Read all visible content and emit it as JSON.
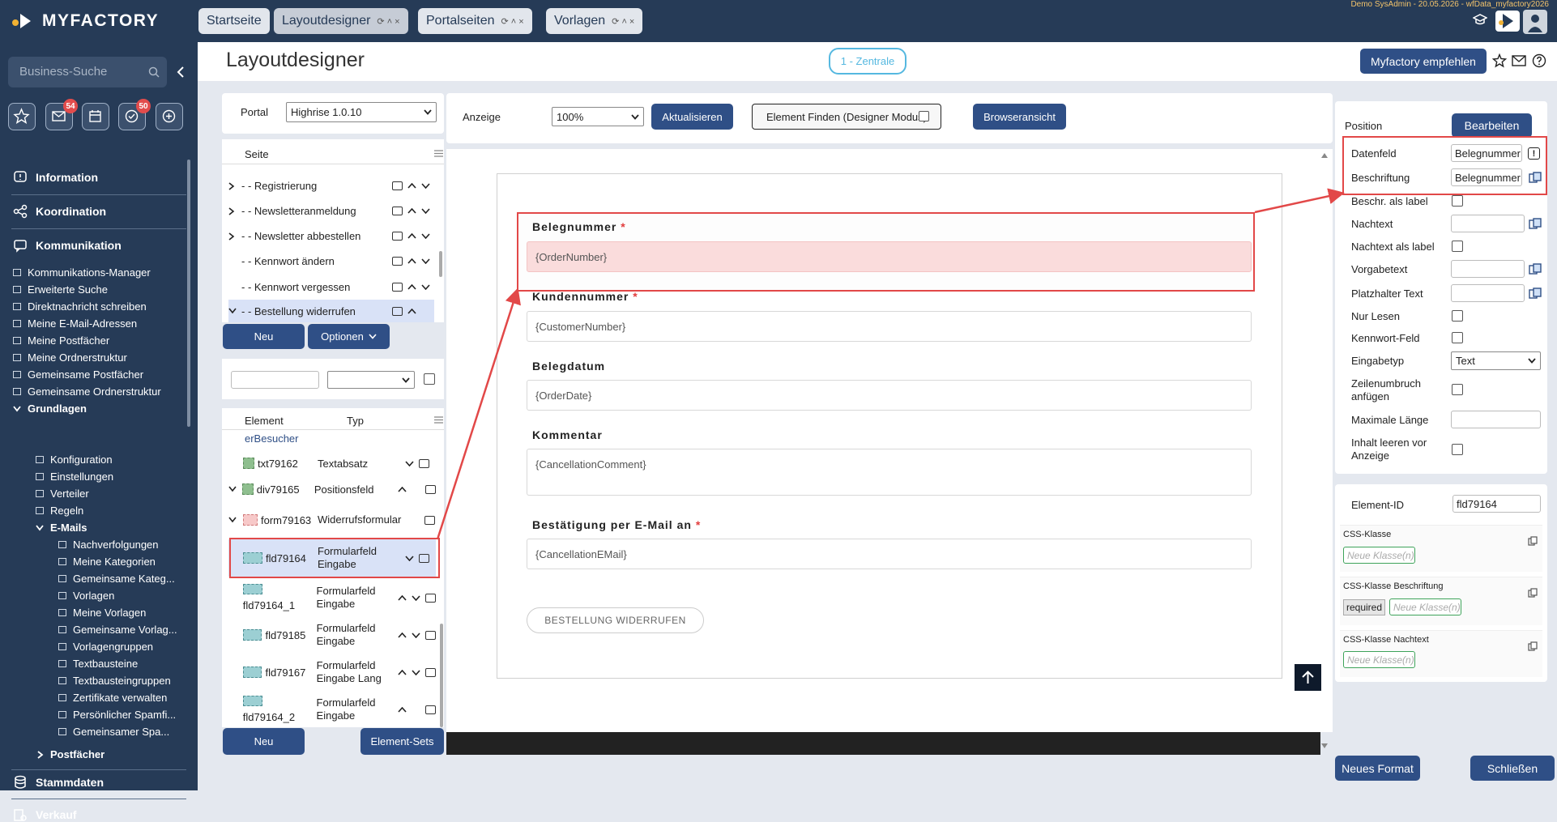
{
  "topbar": {
    "logo": "MYFACTORY",
    "tabs": [
      {
        "label": "Startseite"
      },
      {
        "label": "Layoutdesigner"
      },
      {
        "label": "Portalseiten"
      },
      {
        "label": "Vorlagen"
      }
    ],
    "tab_controls": "⟳ ˄ ×",
    "demo_info": "Demo SysAdmin - 20.05.2026 - wfData_myfactory2026"
  },
  "sidebar": {
    "search_placeholder": "Business-Suche",
    "badges": {
      "mail": "54",
      "tasks": "50"
    },
    "sections": {
      "information": "Information",
      "koordination": "Koordination",
      "kommunikation": "Kommunikation",
      "stammdaten": "Stammdaten",
      "verkauf": "Verkauf"
    },
    "kommunikation_items": [
      "Kommunikations-Manager",
      "Erweiterte Suche",
      "Direktnachricht schreiben",
      "Meine E-Mail-Adressen",
      "Meine Postfächer",
      "Meine Ordnerstruktur",
      "Gemeinsame Postfächer",
      "Gemeinsame Ordnerstruktur"
    ],
    "grundlagen": "Grundlagen",
    "grundlagen_items": [
      "Konfiguration",
      "Einstellungen",
      "Verteiler",
      "Regeln"
    ],
    "emails": "E-Mails",
    "email_items": [
      "Nachverfolgungen",
      "Meine Kategorien",
      "Gemeinsame Kateg...",
      "Vorlagen",
      "Meine Vorlagen",
      "Gemeinsame Vorlag...",
      "Vorlagengruppen",
      "Textbausteine",
      "Textbausteingruppen",
      "Zertifikate verwalten",
      "Persönlicher Spamfi...",
      "Gemeinsamer Spa..."
    ],
    "postfaecher": "Postfächer"
  },
  "header": {
    "title": "Layoutdesigner",
    "zentrale": "1 - Zentrale",
    "recommend": "Myfactory empfehlen"
  },
  "portal": {
    "label": "Portal",
    "value": "Highrise 1.0.10"
  },
  "pages": {
    "header": "Seite",
    "rows": [
      {
        "label": "- - Registrierung"
      },
      {
        "label": "- - Newsletteranmeldung"
      },
      {
        "label": "- - Newsletter abbestellen"
      },
      {
        "label": "- - Kennwort ändern"
      },
      {
        "label": "- - Kennwort vergessen"
      },
      {
        "label": "- - Bestellung widerrufen"
      }
    ],
    "new_button": "Neu",
    "options_button": "Optionen"
  },
  "elements": {
    "headers": {
      "element": "Element",
      "type": "Typ"
    },
    "partial": "erBesucher",
    "rows": [
      {
        "id": "txt79162",
        "type": "Textabsatz"
      },
      {
        "id": "div79165",
        "type": "Positionsfeld"
      },
      {
        "id": "form79163",
        "type": "Widerrufsformular"
      },
      {
        "id": "fld79164",
        "type": "Formularfeld Eingabe"
      },
      {
        "id": "fld79164_1",
        "type": "Formularfeld Eingabe"
      },
      {
        "id": "fld79185",
        "type": "Formularfeld Eingabe"
      },
      {
        "id": "fld79167",
        "type": "Formularfeld Eingabe Lang"
      },
      {
        "id": "fld79164_2",
        "type": "Formularfeld Eingabe"
      }
    ],
    "new_button": "Neu",
    "sets_button": "Element-Sets"
  },
  "toolbar": {
    "display_label": "Anzeige",
    "zoom": "100%",
    "refresh": "Aktualisieren",
    "find": "Element Finden (Designer Modus)",
    "browser": "Browseransicht"
  },
  "form": {
    "fields": [
      {
        "label": "Belegnummer",
        "value": "{OrderNumber}",
        "required": "*"
      },
      {
        "label": "Kundennummer",
        "value": "{CustomerNumber}",
        "required": "*"
      },
      {
        "label": "Belegdatum",
        "value": "{OrderDate}",
        "required": ""
      },
      {
        "label": "Kommentar",
        "value": "{CancellationComment}",
        "required": ""
      },
      {
        "label": "Bestätigung per E-Mail an",
        "value": "{CancellationEMail}",
        "required": "*"
      }
    ],
    "submit": "BESTELLUNG WIDERRUFEN"
  },
  "props": {
    "position": "Position",
    "edit": "Bearbeiten",
    "datenfeld": "Datenfeld",
    "datenfeld_value": "Belegnummer",
    "beschriftung": "Beschriftung",
    "beschriftung_value": "Belegnummer",
    "beschr_label": "Beschr. als label",
    "nachtext": "Nachtext",
    "nachtext_label": "Nachtext als label",
    "vorgabetext": "Vorgabetext",
    "platzhalter": "Platzhalter Text",
    "nur_lesen": "Nur Lesen",
    "kennwort": "Kennwort-Feld",
    "eingabetyp": "Eingabetyp",
    "eingabetyp_value": "Text",
    "zeilenumbruch": "Zeilenumbruch anfügen",
    "max_laenge": "Maximale Länge",
    "inhalt_leeren": "Inhalt leeren vor Anzeige",
    "element_id_label": "Element-ID",
    "element_id": "fld79164",
    "css_class": "CSS-Klasse",
    "css_class_beschr": "CSS-Klasse Beschriftung",
    "css_class_nachtext": "CSS-Klasse Nachtext",
    "new_class_placeholder": "Neue Klasse(n)",
    "required_tag": "required"
  },
  "footer": {
    "new_format": "Neues Format",
    "close": "Schließen"
  }
}
